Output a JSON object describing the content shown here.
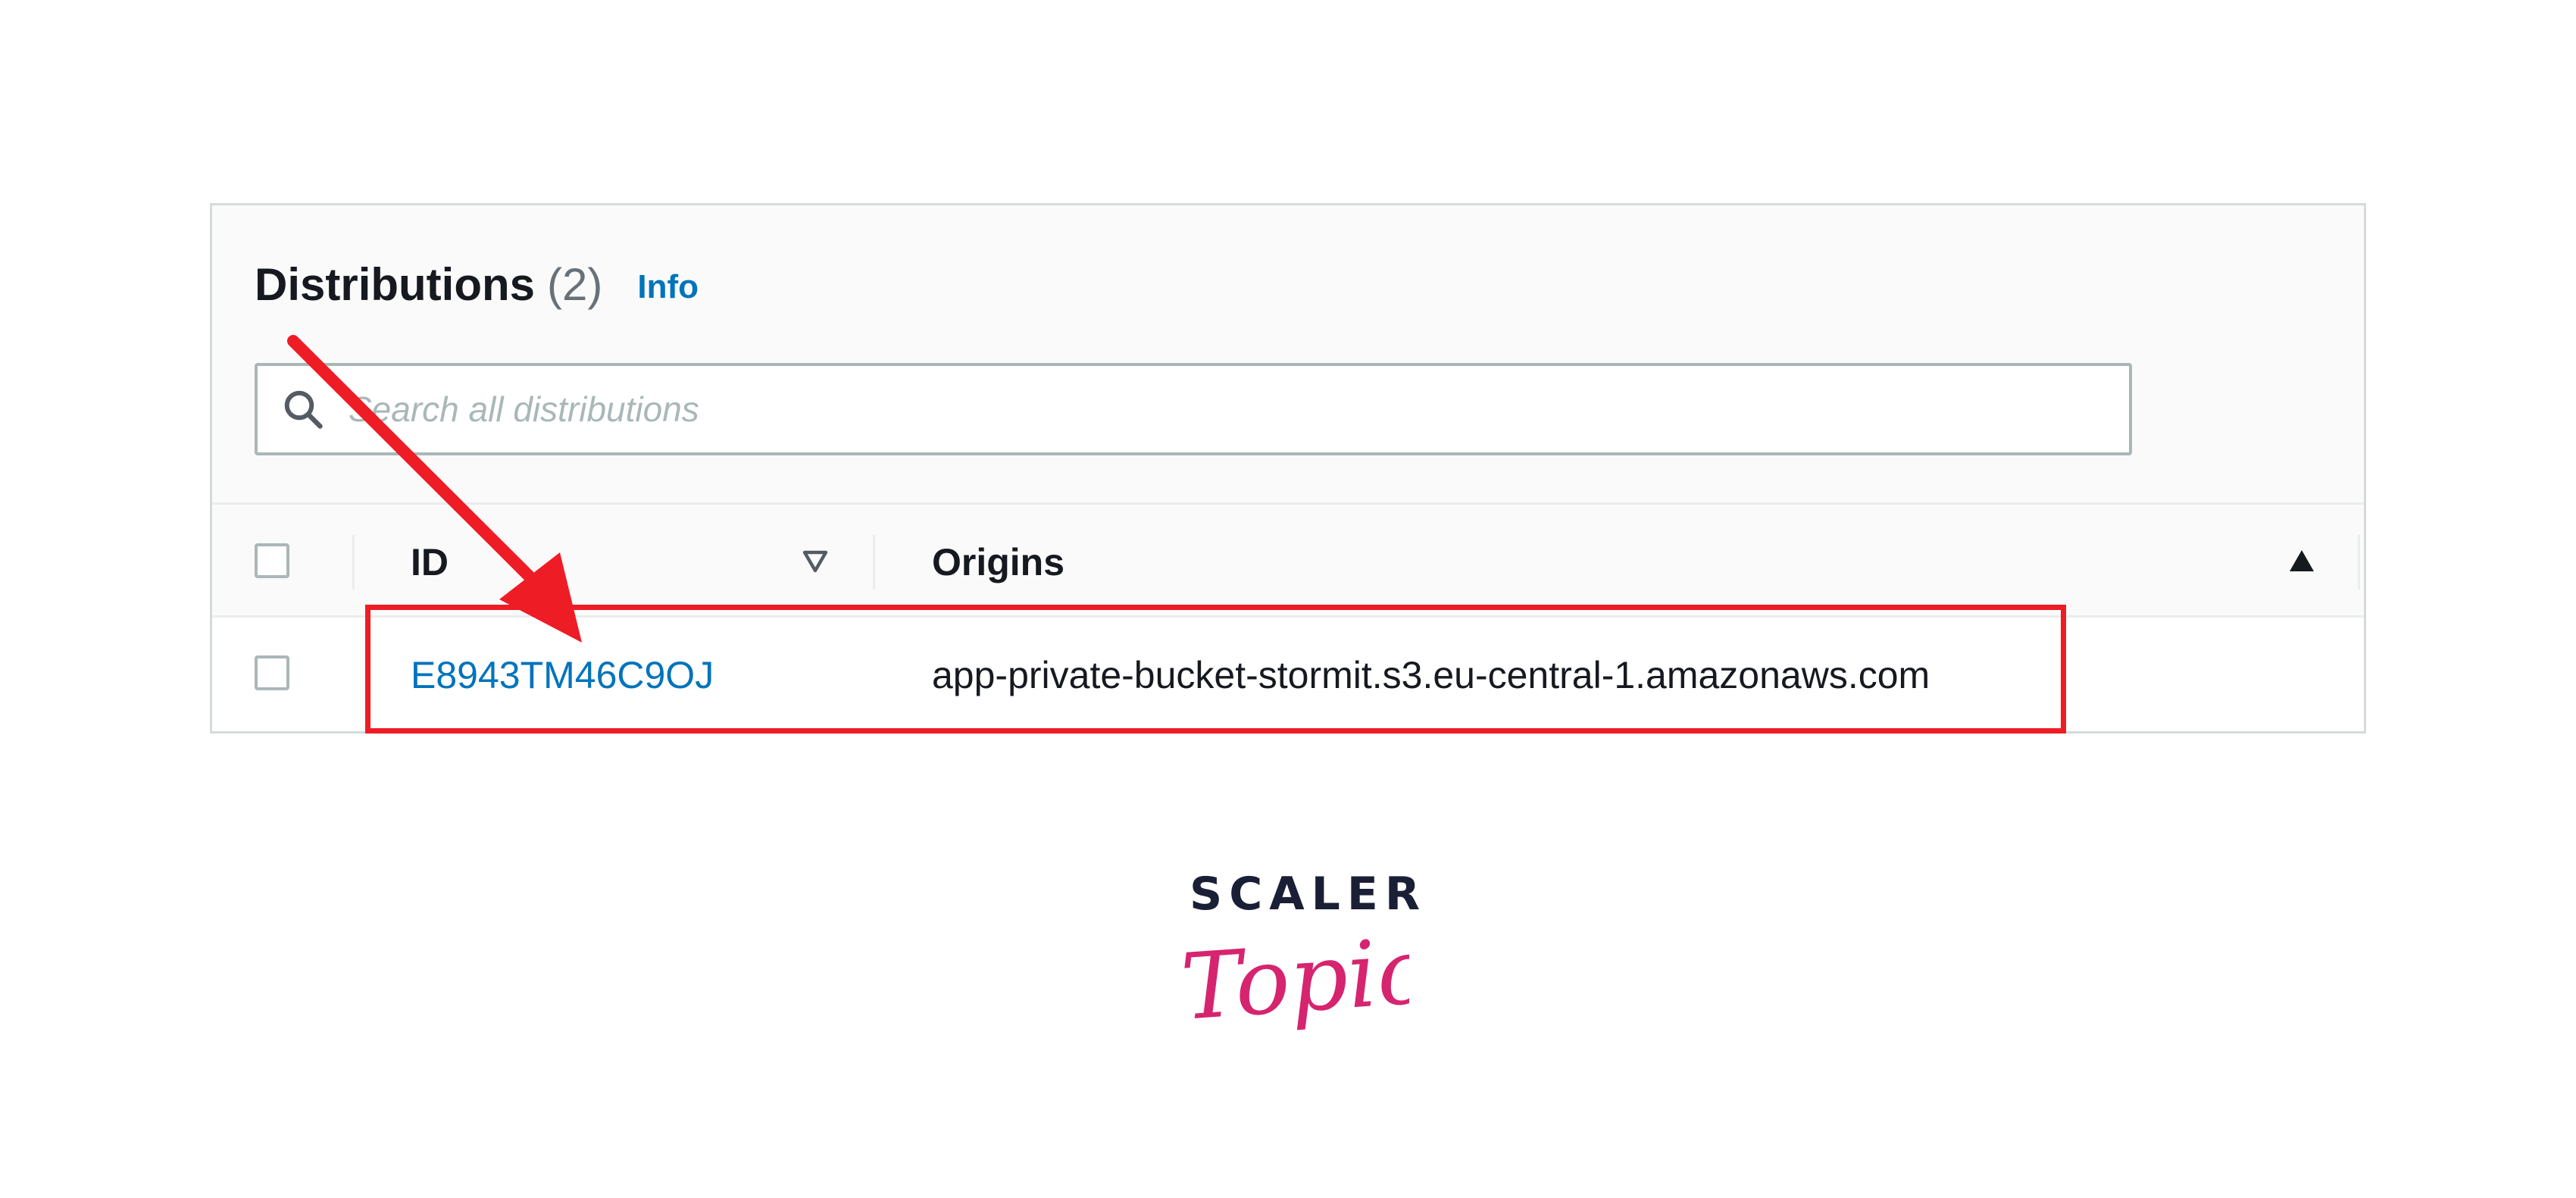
{
  "panel": {
    "title": "Distributions",
    "count": "(2)",
    "info_label": "Info"
  },
  "search": {
    "placeholder": "Search all distributions",
    "value": ""
  },
  "table": {
    "columns": [
      {
        "label": "ID",
        "sort": "filter-down"
      },
      {
        "label": "Origins",
        "sort": "ascending"
      }
    ],
    "rows": [
      {
        "id": "E8943TM46C9OJ",
        "origin": "app-private-bucket-stormit.s3.eu-central-1.amazonaws.com",
        "selected": false
      }
    ]
  },
  "annotation": {
    "highlight_color": "#ee1c25"
  },
  "brand": {
    "top_text": "SCALER",
    "bottom_text": "Topics",
    "top_color": "#1a1f36",
    "bottom_color": "#d6246e"
  },
  "colors": {
    "link": "#0073bb",
    "text": "#16191f",
    "muted": "#687078",
    "border": "#aab7b8"
  }
}
